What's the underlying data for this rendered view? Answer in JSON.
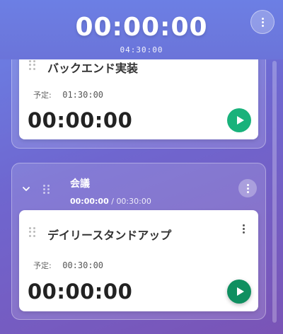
{
  "header": {
    "timer": "00:00:00",
    "total": "04:30:00"
  },
  "groups": [
    {
      "tasks": [
        {
          "title": "バックエンド実装",
          "planned_label": "予定:",
          "planned_value": "01:30:00",
          "timer": "00:00:00"
        }
      ]
    },
    {
      "name": "会議",
      "elapsed": "00:00:00",
      "separator": " / ",
      "planned": "00:30:00",
      "tasks": [
        {
          "title": "デイリースタンドアップ",
          "planned_label": "予定:",
          "planned_value": "00:30:00",
          "timer": "00:00:00"
        }
      ]
    }
  ],
  "colors": {
    "play": "#19b27b",
    "play_active": "#0f8f60"
  },
  "icons": {
    "menu": "more-vertical-icon",
    "play": "play-icon",
    "collapse": "chevron-down-icon",
    "drag": "drag-handle-icon"
  }
}
